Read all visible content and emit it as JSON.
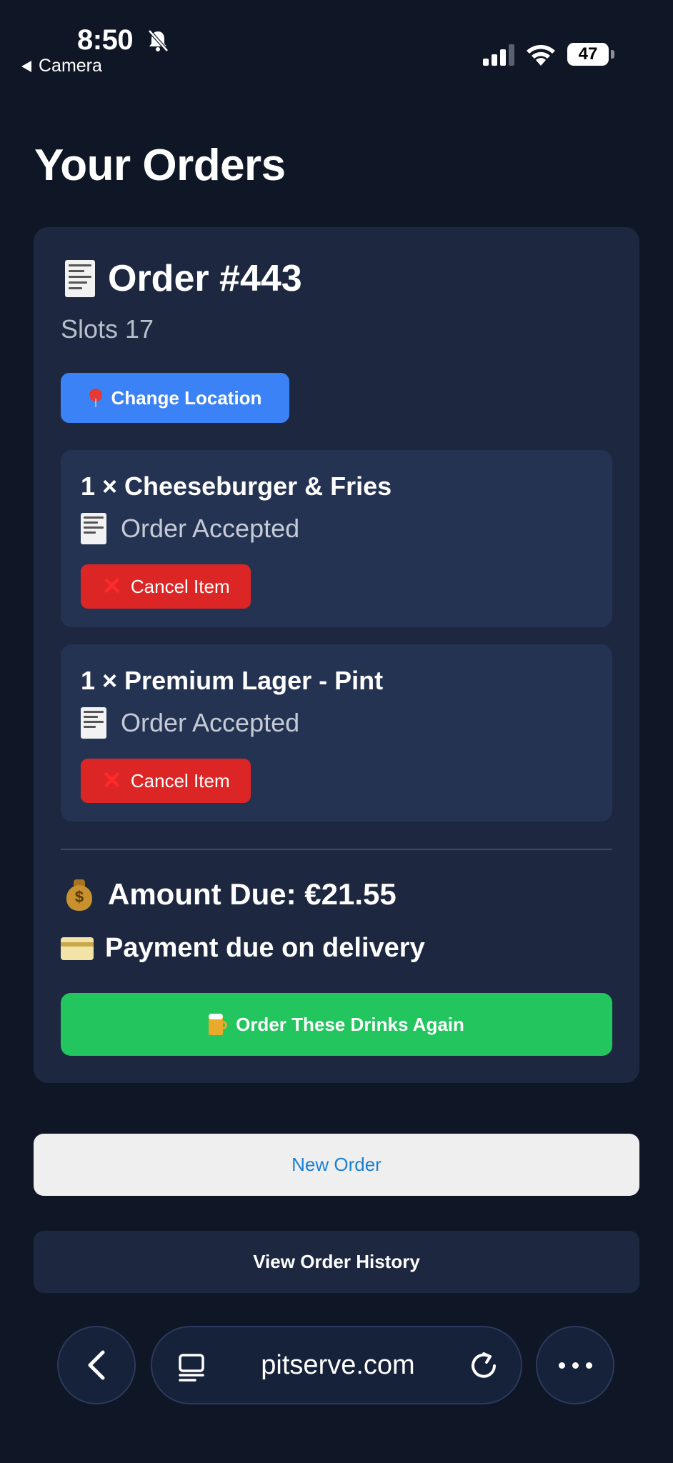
{
  "status_bar": {
    "time": "8:50",
    "back_label": "Camera",
    "battery_level": "47"
  },
  "page": {
    "title": "Your Orders"
  },
  "order": {
    "title": "Order #443",
    "location": "Slots 17",
    "change_location_label": "Change Location",
    "items": [
      {
        "name": "1 × Cheeseburger & Fries",
        "status": "Order Accepted",
        "cancel_label": "Cancel Item"
      },
      {
        "name": "1 × Premium Lager - Pint",
        "status": "Order Accepted",
        "cancel_label": "Cancel Item"
      }
    ],
    "amount_due": "Amount Due: €21.55",
    "payment_note": "Payment due on delivery",
    "reorder_label": "Order These Drinks Again"
  },
  "actions": {
    "new_order_label": "New Order",
    "history_label": "View Order History"
  },
  "browser": {
    "url": "pitserve.com"
  },
  "colors": {
    "background": "#0f1726",
    "card": "#1d2840",
    "item_card": "#253352",
    "primary_blue": "#3b82f6",
    "danger_red": "#dc2626",
    "success_green": "#22c55e",
    "link_blue": "#1a7fd6"
  },
  "icons": {
    "status_bar": [
      "bell-slash-icon",
      "signal-icon",
      "wifi-icon",
      "battery-icon"
    ],
    "order": [
      "receipt-icon",
      "pin-icon",
      "x-icon",
      "moneybag-icon",
      "credit-card-icon",
      "beer-mug-icon"
    ],
    "browser": [
      "chevron-left-icon",
      "reader-icon",
      "reload-icon",
      "more-icon"
    ]
  }
}
